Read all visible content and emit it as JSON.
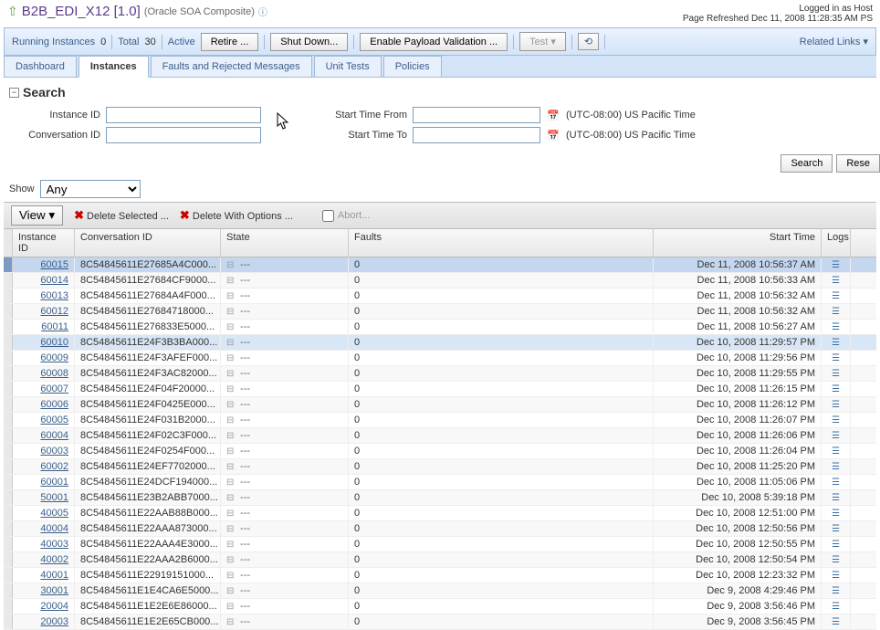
{
  "header": {
    "title": "B2B_EDI_X12 [1.0]",
    "subtitle": "(Oracle SOA Composite)",
    "logged_in": "Logged in as Host",
    "refreshed": "Page Refreshed Dec 11, 2008 11:28:35 AM PS"
  },
  "toolbar": {
    "running_label": "Running Instances",
    "running_count": "0",
    "total_label": "Total",
    "total_count": "30",
    "active": "Active",
    "retire": "Retire ...",
    "shutdown": "Shut Down...",
    "payload": "Enable Payload Validation ...",
    "test": "Test",
    "related": "Related Links"
  },
  "tabs": [
    {
      "label": "Dashboard"
    },
    {
      "label": "Instances"
    },
    {
      "label": "Faults and Rejected Messages"
    },
    {
      "label": "Unit Tests"
    },
    {
      "label": "Policies"
    }
  ],
  "search": {
    "title": "Search",
    "instance_id_label": "Instance ID",
    "conversation_id_label": "Conversation ID",
    "start_from_label": "Start Time From",
    "start_to_label": "Start Time To",
    "tz": "(UTC-08:00) US Pacific Time",
    "search_btn": "Search",
    "reset_btn": "Rese"
  },
  "show": {
    "label": "Show",
    "value": "Any"
  },
  "grid_toolbar": {
    "view": "View",
    "delete_selected": "Delete Selected ...",
    "delete_options": "Delete With Options ...",
    "abort": "Abort..."
  },
  "columns": {
    "instance_id": "Instance ID",
    "conversation_id": "Conversation ID",
    "state": "State",
    "faults": "Faults",
    "start_time": "Start Time",
    "logs": "Logs"
  },
  "rows": [
    {
      "id": "60015",
      "conv": "8C54845611E27685A4C000...",
      "state": "---",
      "faults": "0",
      "start": "Dec 11, 2008 10:56:37 AM",
      "sel": true
    },
    {
      "id": "60014",
      "conv": "8C54845611E27684CF9000...",
      "state": "---",
      "faults": "0",
      "start": "Dec 11, 2008 10:56:33 AM"
    },
    {
      "id": "60013",
      "conv": "8C54845611E27684A4F000...",
      "state": "---",
      "faults": "0",
      "start": "Dec 11, 2008 10:56:32 AM"
    },
    {
      "id": "60012",
      "conv": "8C54845611E27684718000...",
      "state": "---",
      "faults": "0",
      "start": "Dec 11, 2008 10:56:32 AM"
    },
    {
      "id": "60011",
      "conv": "8C54845611E276833E5000...",
      "state": "---",
      "faults": "0",
      "start": "Dec 11, 2008 10:56:27 AM"
    },
    {
      "id": "60010",
      "conv": "8C54845611E24F3B3BA000...",
      "state": "---",
      "faults": "0",
      "start": "Dec 10, 2008 11:29:57 PM",
      "hl": true
    },
    {
      "id": "60009",
      "conv": "8C54845611E24F3AFEF000...",
      "state": "---",
      "faults": "0",
      "start": "Dec 10, 2008 11:29:56 PM"
    },
    {
      "id": "60008",
      "conv": "8C54845611E24F3AC82000...",
      "state": "---",
      "faults": "0",
      "start": "Dec 10, 2008 11:29:55 PM"
    },
    {
      "id": "60007",
      "conv": "8C54845611E24F04F20000...",
      "state": "---",
      "faults": "0",
      "start": "Dec 10, 2008 11:26:15 PM"
    },
    {
      "id": "60006",
      "conv": "8C54845611E24F0425E000...",
      "state": "---",
      "faults": "0",
      "start": "Dec 10, 2008 11:26:12 PM"
    },
    {
      "id": "60005",
      "conv": "8C54845611E24F031B2000...",
      "state": "---",
      "faults": "0",
      "start": "Dec 10, 2008 11:26:07 PM"
    },
    {
      "id": "60004",
      "conv": "8C54845611E24F02C3F000...",
      "state": "---",
      "faults": "0",
      "start": "Dec 10, 2008 11:26:06 PM"
    },
    {
      "id": "60003",
      "conv": "8C54845611E24F0254F000...",
      "state": "---",
      "faults": "0",
      "start": "Dec 10, 2008 11:26:04 PM"
    },
    {
      "id": "60002",
      "conv": "8C54845611E24EF7702000...",
      "state": "---",
      "faults": "0",
      "start": "Dec 10, 2008 11:25:20 PM"
    },
    {
      "id": "60001",
      "conv": "8C54845611E24DCF194000...",
      "state": "---",
      "faults": "0",
      "start": "Dec 10, 2008 11:05:06 PM"
    },
    {
      "id": "50001",
      "conv": "8C54845611E23B2ABB7000...",
      "state": "---",
      "faults": "0",
      "start": "Dec 10, 2008 5:39:18 PM"
    },
    {
      "id": "40005",
      "conv": "8C54845611E22AAB88B000...",
      "state": "---",
      "faults": "0",
      "start": "Dec 10, 2008 12:51:00 PM"
    },
    {
      "id": "40004",
      "conv": "8C54845611E22AAA873000...",
      "state": "---",
      "faults": "0",
      "start": "Dec 10, 2008 12:50:56 PM"
    },
    {
      "id": "40003",
      "conv": "8C54845611E22AAA4E3000...",
      "state": "---",
      "faults": "0",
      "start": "Dec 10, 2008 12:50:55 PM"
    },
    {
      "id": "40002",
      "conv": "8C54845611E22AAA2B6000...",
      "state": "---",
      "faults": "0",
      "start": "Dec 10, 2008 12:50:54 PM"
    },
    {
      "id": "40001",
      "conv": "8C54845611E22919151000...",
      "state": "---",
      "faults": "0",
      "start": "Dec 10, 2008 12:23:32 PM"
    },
    {
      "id": "30001",
      "conv": "8C54845611E1E4CA6E5000...",
      "state": "---",
      "faults": "0",
      "start": "Dec 9, 2008 4:29:46 PM"
    },
    {
      "id": "20004",
      "conv": "8C54845611E1E2E6E86000...",
      "state": "---",
      "faults": "0",
      "start": "Dec 9, 2008 3:56:46 PM"
    },
    {
      "id": "20003",
      "conv": "8C54845611E1E2E65CB000...",
      "state": "---",
      "faults": "0",
      "start": "Dec 9, 2008 3:56:45 PM"
    }
  ]
}
